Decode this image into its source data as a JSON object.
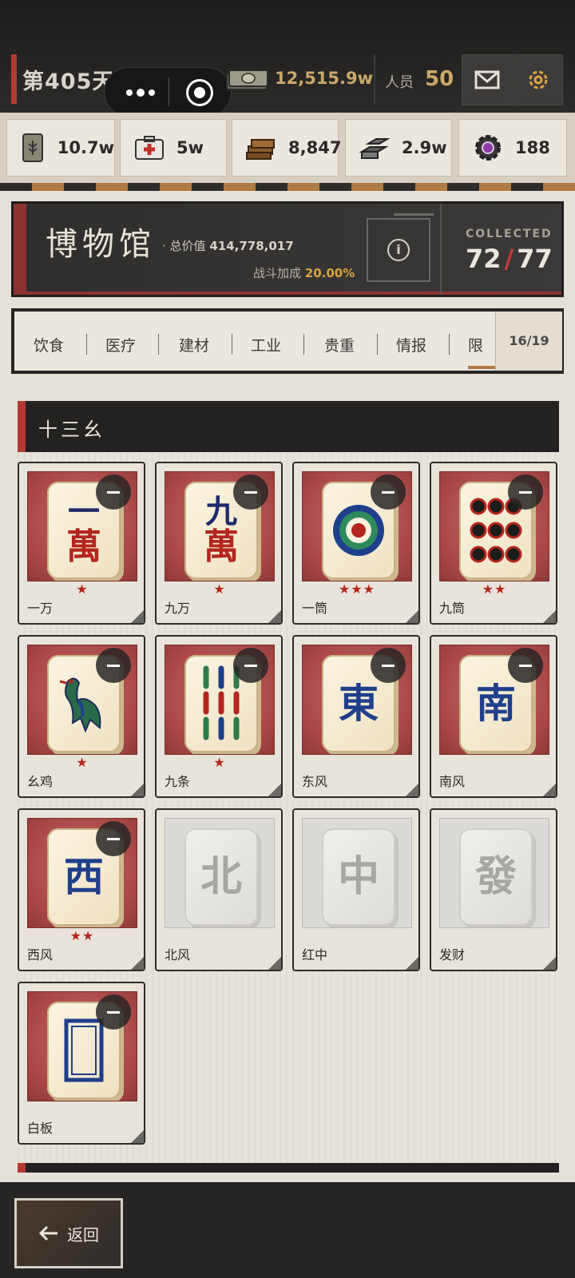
{
  "header": {
    "day": "第405天",
    "money": "12,515.9w",
    "staff_label": "人员",
    "staff_value": "50"
  },
  "resources": [
    {
      "icon": "grain-sack-icon",
      "value": "10.7w"
    },
    {
      "icon": "medkit-icon",
      "value": "5w"
    },
    {
      "icon": "wood-planks-icon",
      "value": "8,847"
    },
    {
      "icon": "steel-ingots-icon",
      "value": "2.9w"
    },
    {
      "icon": "gear-chip-icon",
      "value": "188"
    }
  ],
  "museum": {
    "title": "博物馆",
    "total_label": "· 总价值",
    "total_value": "414,778,017",
    "bonus_label": "战斗加成",
    "bonus_value": "20.00%",
    "collected_label": "COLLECTED",
    "collected_count": "72",
    "collected_total": "77"
  },
  "tabs": {
    "items": [
      "饮食",
      "医疗",
      "建材",
      "工业",
      "贵重",
      "情报",
      "限"
    ],
    "active": "限",
    "count": "16/19"
  },
  "section": {
    "title": "十三幺"
  },
  "tiles": [
    {
      "name": "一万",
      "stars": "★",
      "glyph_top": "一",
      "glyph": "萬",
      "style": "red",
      "owned": true
    },
    {
      "name": "九万",
      "stars": "★",
      "glyph_top": "九",
      "glyph": "萬",
      "style": "red",
      "owned": true
    },
    {
      "name": "一筒",
      "stars": "★★★",
      "glyph": "",
      "style": "circle",
      "owned": true
    },
    {
      "name": "九筒",
      "stars": "★★",
      "glyph": "",
      "style": "ninecircle",
      "owned": true
    },
    {
      "name": "幺鸡",
      "stars": "★",
      "glyph": "",
      "style": "bird",
      "owned": true
    },
    {
      "name": "九条",
      "stars": "★",
      "glyph": "",
      "style": "bamboo",
      "owned": true
    },
    {
      "name": "东风",
      "stars": "",
      "glyph": "東",
      "style": "blue",
      "owned": true
    },
    {
      "name": "南风",
      "stars": "",
      "glyph": "南",
      "style": "blue",
      "owned": true
    },
    {
      "name": "西风",
      "stars": "★★",
      "glyph": "西",
      "style": "blue",
      "owned": true
    },
    {
      "name": "北风",
      "stars": "",
      "glyph": "北",
      "style": "grey",
      "owned": false
    },
    {
      "name": "红中",
      "stars": "",
      "glyph": "中",
      "style": "grey",
      "owned": false
    },
    {
      "name": "发财",
      "stars": "",
      "glyph": "發",
      "style": "grey",
      "owned": false
    },
    {
      "name": "白板",
      "stars": "",
      "glyph": "",
      "style": "white",
      "owned": true
    }
  ],
  "footer": {
    "back_label": "返回"
  },
  "colors": {
    "accent_red": "#b63a33",
    "gold": "#c9a86b",
    "bonus_gold": "#d9a440"
  }
}
